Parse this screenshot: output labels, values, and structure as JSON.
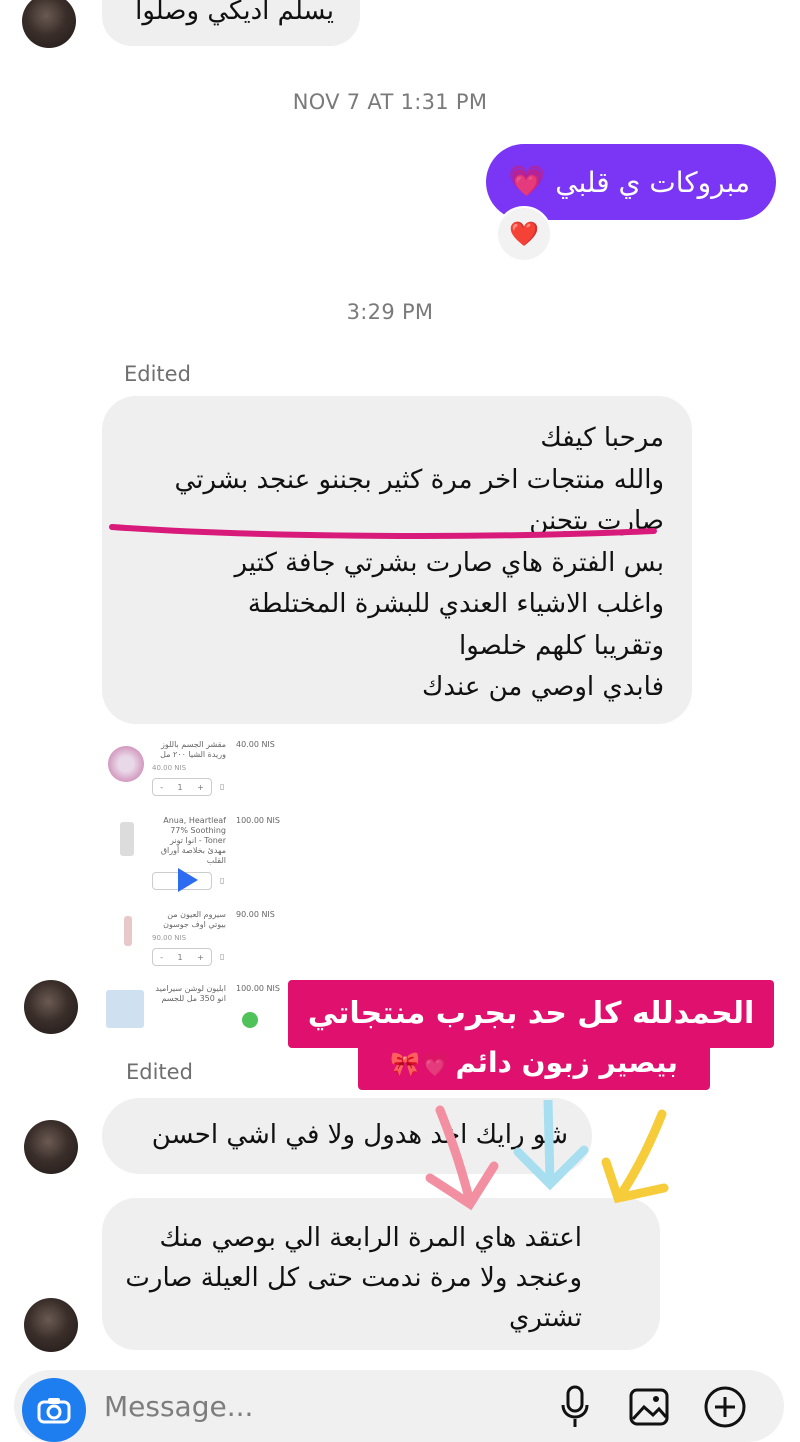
{
  "messages": {
    "top_partial": "يسلم اديكي وصلوا",
    "timestamp_1": "NOV 7 AT 1:31 PM",
    "outgoing_1": "مبروكات ي قلبي",
    "timestamp_2": "3:29 PM",
    "edited_label_1": "Edited",
    "incoming_long": [
      "مرحبا كيفك",
      "والله منتجات اخر مرة كثير بجننو عنجد بشرتي",
      "صارت بتجنن",
      "بس الفترة هاي صارت بشرتي جافة كتير",
      "واغلب الاشياء العندي للبشرة المختلطة",
      "وتقريبا كلهم خلصوا",
      "فابدي اوصي من عندك"
    ],
    "edited_label_2": "Edited",
    "incoming_question": "شو رايك اخد هدول ولا في اشي احسن",
    "incoming_last": [
      "اعتقد هاي المرة الرابعة الي بوصي منك",
      "وعنجد ولا مرة ندمت حتى كل العيلة صارت",
      "تشتري"
    ]
  },
  "products": [
    {
      "name": "مقشر الجسم باللوز وريدة الشيا ٢٠٠ مل",
      "price": "40.00 NIS",
      "subprice": "40.00 NIS",
      "thumb_color": "#c46aa0"
    },
    {
      "name": "Anua, Heartleaf 77% Soothing Toner - انوا تونر مهدئ بخلاصة أوراق القلب",
      "price": "100.00 NIS",
      "subprice": "100.00 NIS",
      "thumb_color": "#d8d8d8"
    },
    {
      "name": "سيروم العيون من بيوتي اوف جوسون",
      "price": "90.00 NIS",
      "subprice": "90.00 NIS",
      "thumb_color": "#e8c8c8"
    },
    {
      "name": "ابليون لوشن سيراميد انو 350 مل للجسم",
      "price": "100.00 NIS",
      "subprice": "",
      "thumb_color": "#cfe0f0"
    }
  ],
  "stepper": {
    "minus": "-",
    "qty": "1",
    "plus": "+"
  },
  "sticker": {
    "line1": "الحمدلله كل حد بجرب منتجاتي",
    "line2": "بيصير زبون دائم",
    "line2_emoji": "💗🎀"
  },
  "composer": {
    "placeholder": "Message..."
  },
  "colors": {
    "outgoing_bubble": "#7b35f5",
    "incoming_bubble": "#efefef",
    "sticker_bg": "#e0106f",
    "underline": "#d81b7a",
    "arrow_pink": "#f28fa0",
    "arrow_blue": "#a8dff0",
    "arrow_yellow": "#f7cc3a",
    "camera": "#1e7ef0"
  },
  "icons": {
    "outgoing_emoji": "💗",
    "reaction": "❤️"
  }
}
